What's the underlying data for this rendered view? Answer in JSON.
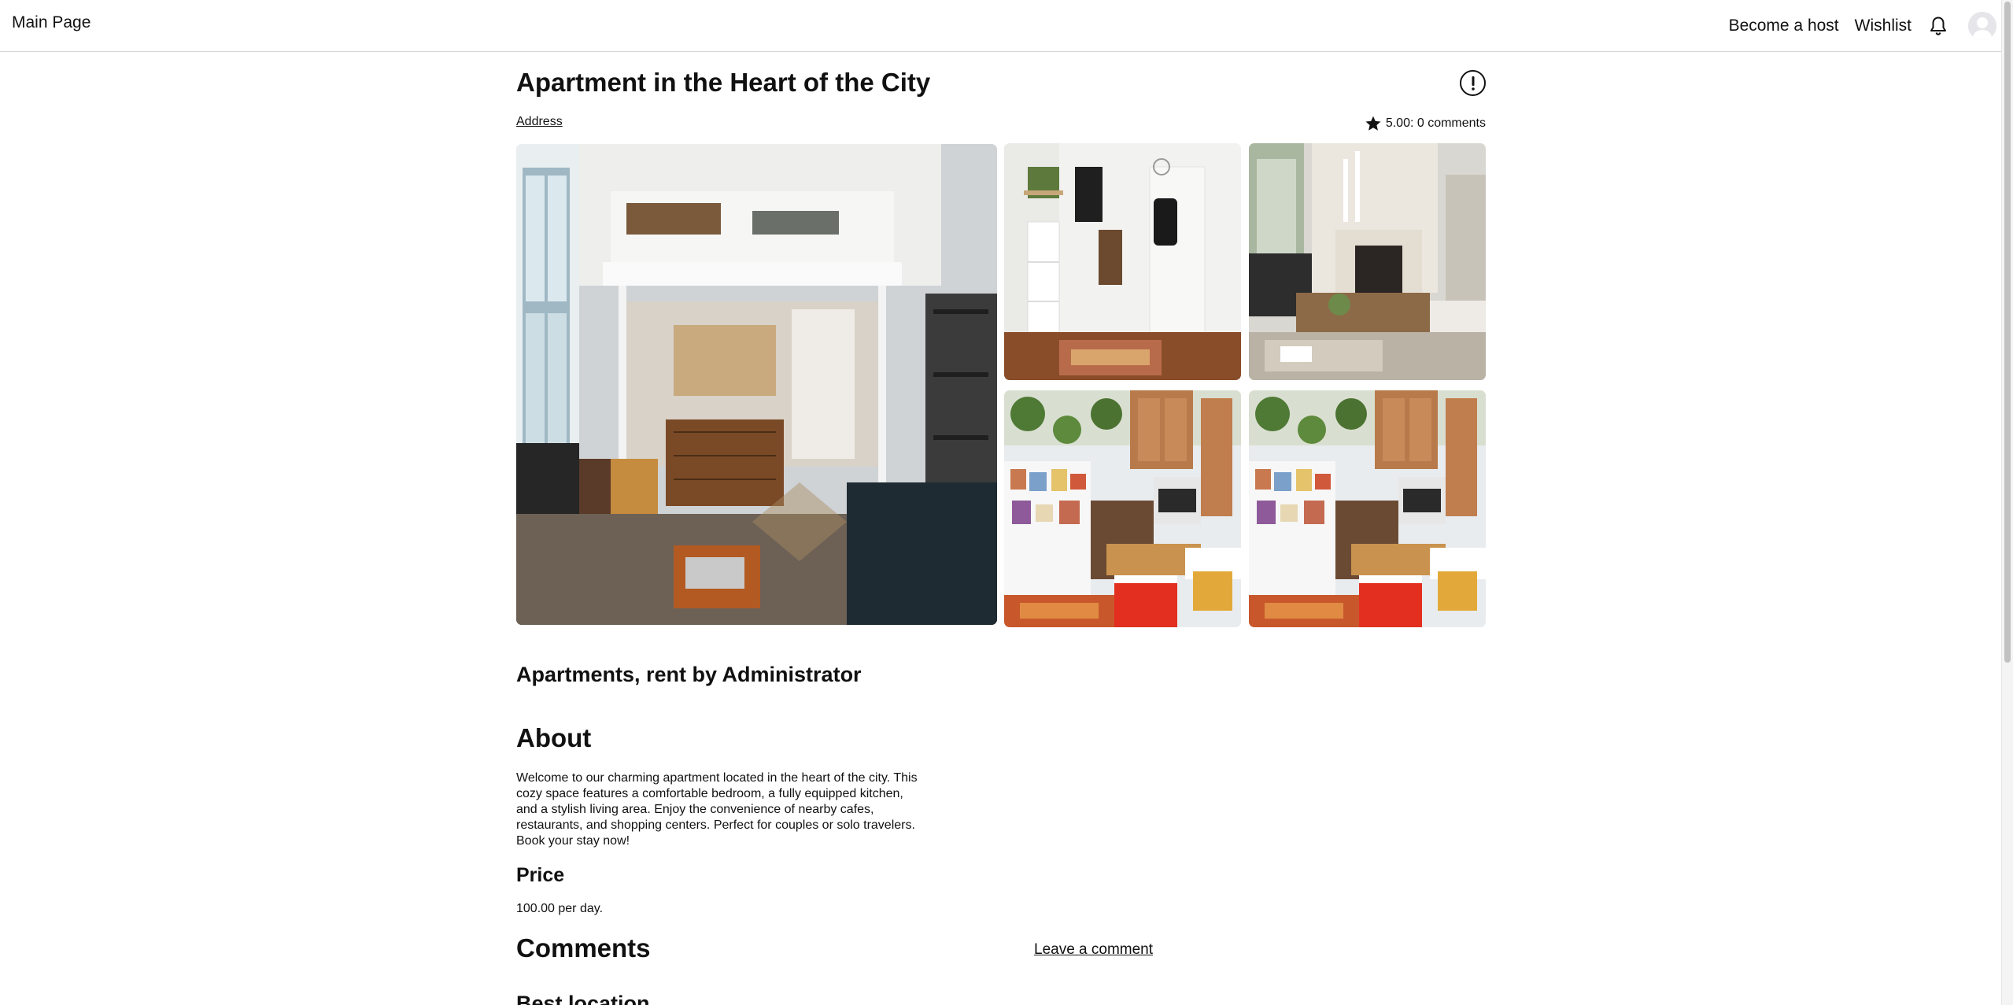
{
  "nav": {
    "brand": "Main Page",
    "become_host": "Become a host",
    "wishlist": "Wishlist",
    "bell_icon": "bell-icon",
    "avatar_icon": "user-avatar-icon"
  },
  "listing": {
    "title": "Apartment in the Heart of the City",
    "address_link": "Address",
    "rating_text": "5.00: 0 comments",
    "subtitle": "Apartments, rent by Administrator"
  },
  "gallery": {
    "photos": [
      {
        "name": "loft-bedroom-photo"
      },
      {
        "name": "hallway-photo"
      },
      {
        "name": "living-room-photo"
      },
      {
        "name": "kitchen-photo"
      },
      {
        "name": "kitchen-photo"
      }
    ]
  },
  "about": {
    "heading": "About",
    "text": "Welcome to our charming apartment located in the heart of the city. This cozy space features a comfortable bedroom, a fully equipped kitchen, and a stylish living area. Enjoy the convenience of nearby cafes, restaurants, and shopping centers. Perfect for couples or solo travelers. Book your stay now!"
  },
  "price": {
    "heading": "Price",
    "text": "100.00 per day."
  },
  "comments": {
    "heading": "Comments",
    "leave_link": "Leave a comment"
  },
  "best_location": {
    "heading": "Best location"
  },
  "colors": {
    "text": "#111111",
    "border": "#d6d6d6",
    "background": "#ffffff"
  }
}
